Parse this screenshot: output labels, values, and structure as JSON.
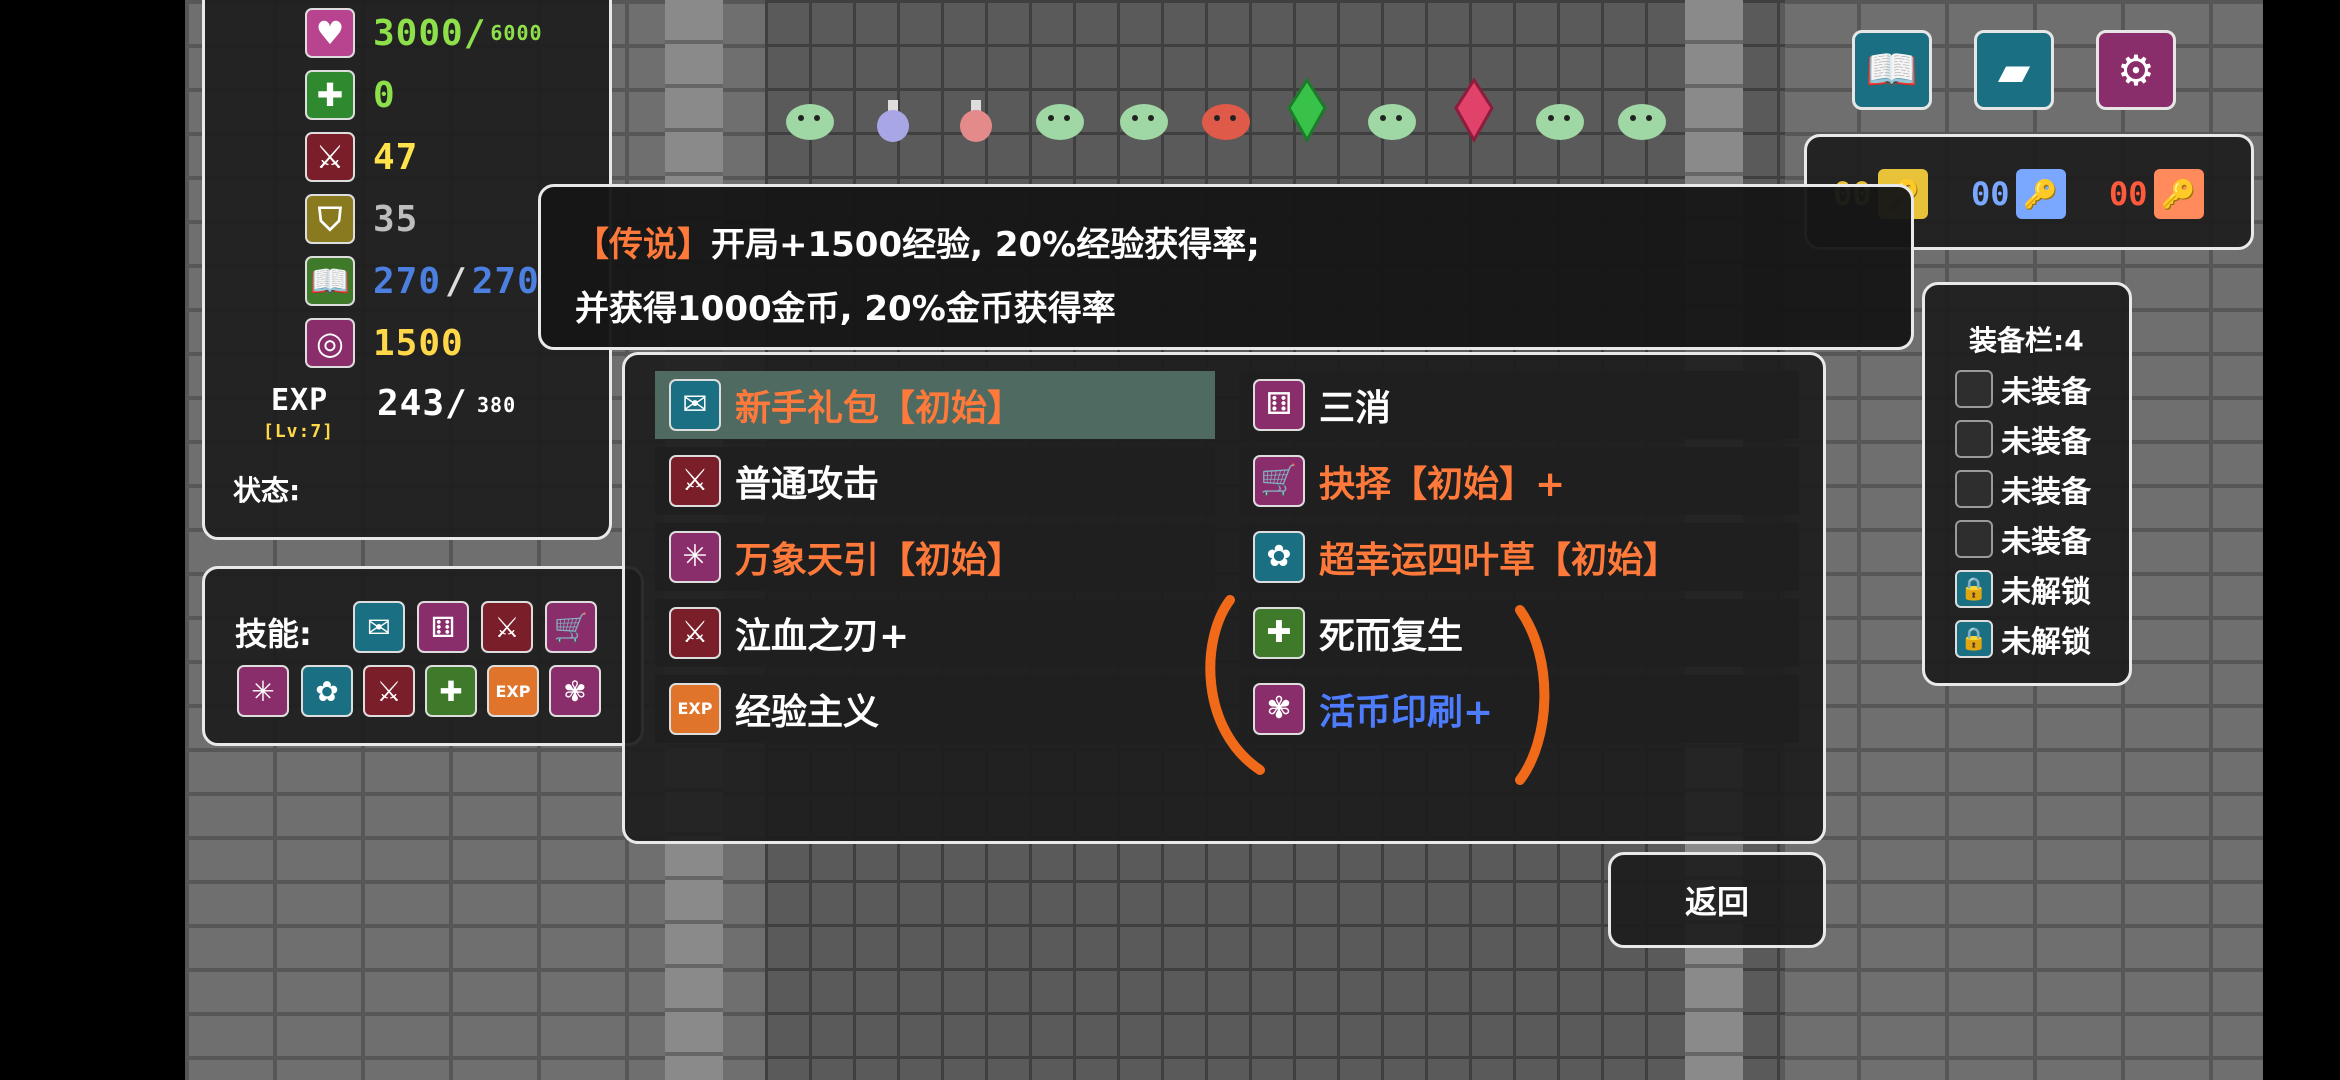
{
  "stats": {
    "hp": "3000/",
    "hp_max": "6000",
    "defense_extra": "0",
    "attack": "47",
    "defense": "35",
    "mp": "270",
    "mp_sep": "/",
    "mp_max": "270",
    "gold": "1500",
    "exp_label": "EXP",
    "exp_value": "243/",
    "exp_max": "380",
    "level": "[Lv:7]",
    "status_label": "状态:"
  },
  "skills_box": {
    "label": "技能:"
  },
  "keys": [
    {
      "count": "00",
      "color": "#e8c33a"
    },
    {
      "count": "00",
      "color": "#7aa7ff"
    },
    {
      "count": "00",
      "color": "#ff5a3c"
    }
  ],
  "top_buttons": [
    {
      "name": "book-icon",
      "color": "#1b6f82"
    },
    {
      "name": "ticket-icon",
      "color": "#1b6f82"
    },
    {
      "name": "settings-wrench-icon",
      "color": "#8a2e6b"
    }
  ],
  "tooltip": {
    "tag": "【传说】",
    "line1": "开局+1500经验, 20%经验获得率;",
    "line2": "并获得1000金币, 20%金币获得率"
  },
  "skill_list": [
    {
      "label": "新手礼包【初始】",
      "color": "#ff7a3a",
      "icon": "envelope-icon",
      "icon_char": "✉",
      "icon_bg": "#1b6f82"
    },
    {
      "label": "三消",
      "color": "#ffffff",
      "icon": "dice-icon",
      "icon_char": "⚅",
      "icon_bg": "#8a2e6b"
    },
    {
      "label": "普通攻击",
      "color": "#ffffff",
      "icon": "sword-icon",
      "icon_char": "⚔",
      "icon_bg": "#7a1f2a"
    },
    {
      "label": "抉择【初始】+",
      "color": "#ff7a3a",
      "icon": "cart-icon",
      "icon_char": "🛒",
      "icon_bg": "#8a2e6b"
    },
    {
      "label": "万象天引【初始】",
      "color": "#ff7a3a",
      "icon": "vortex-icon",
      "icon_char": "✳",
      "icon_bg": "#8a2e6b"
    },
    {
      "label": "超幸运四叶草【初始】",
      "color": "#ff7a3a",
      "icon": "clover-icon",
      "icon_char": "✿",
      "icon_bg": "#1b6f82"
    },
    {
      "label": "泣血之刃+",
      "color": "#ffffff",
      "icon": "bloody-blade-icon",
      "icon_char": "⚔",
      "icon_bg": "#7a1f2a"
    },
    {
      "label": "死而复生",
      "color": "#ffffff",
      "icon": "book-revive-icon",
      "icon_char": "✚",
      "icon_bg": "#3f7a2a"
    },
    {
      "label": "经验主义",
      "color": "#ffffff",
      "icon": "exp-up-icon",
      "icon_char": "▲",
      "icon_bg": "#e0742a"
    },
    {
      "label": "活币印刷+",
      "color": "#4d7cff",
      "icon": "coin-print-icon",
      "icon_char": "✾",
      "icon_bg": "#8a2e6b"
    }
  ],
  "equipment": {
    "title": "装备栏:4",
    "slots": [
      "未装备",
      "未装备",
      "未装备",
      "未装备"
    ],
    "locked": [
      "未解锁",
      "未解锁"
    ]
  },
  "back_button": "返回",
  "colors": {
    "hp": "#8ee04b",
    "mp": "#4c7fe0",
    "gold": "#ffd84a",
    "attack": "#ffe34a",
    "defense": "#bdbdbd",
    "orange": "#ff7a3a",
    "annotation": "#f06a1a"
  }
}
